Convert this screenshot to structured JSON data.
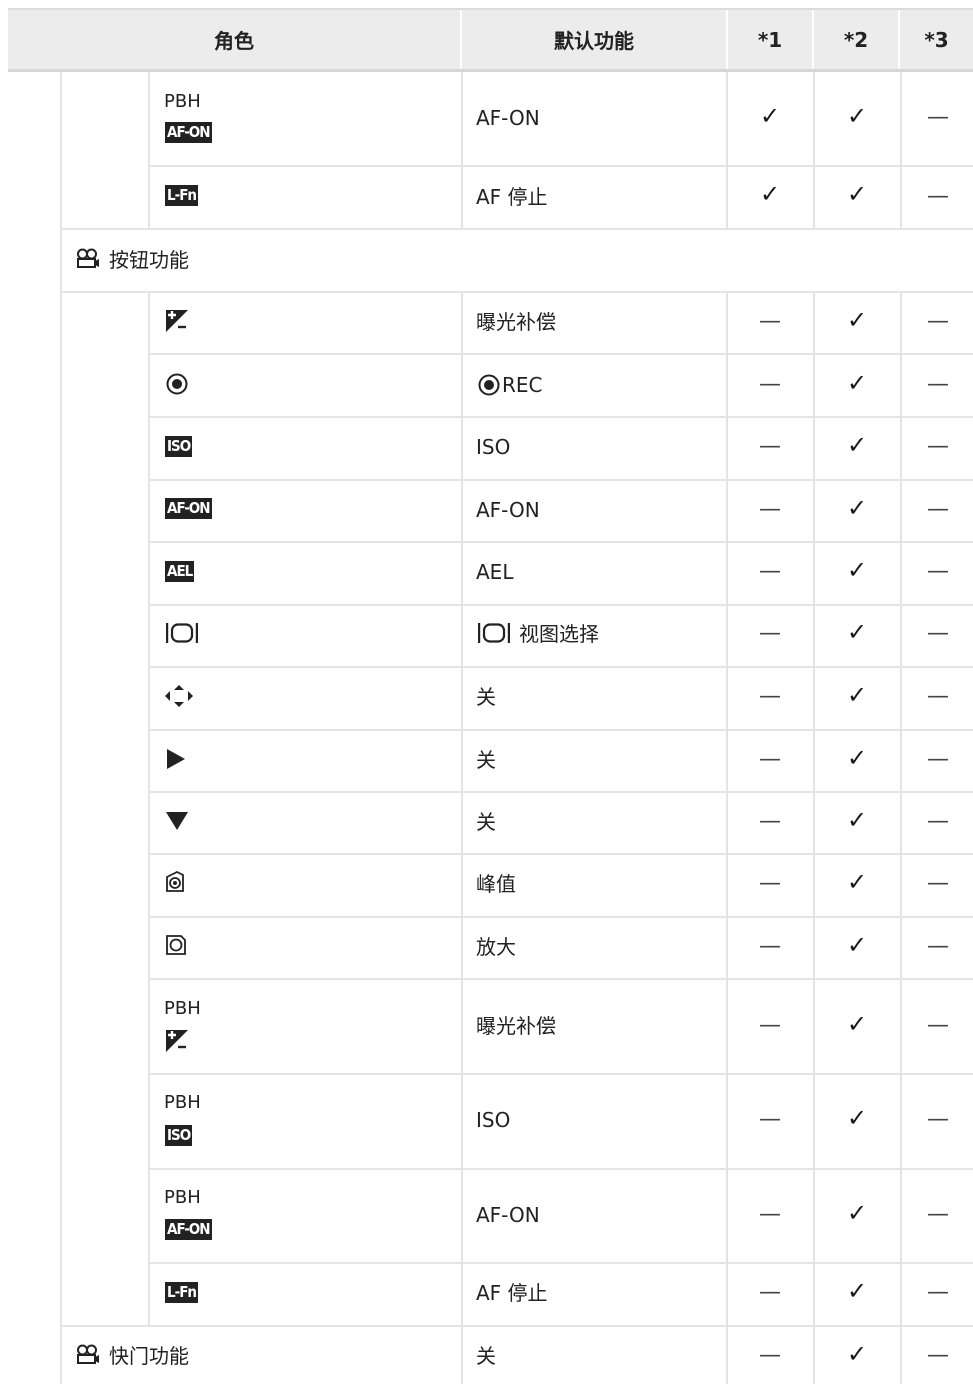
{
  "header": {
    "role": "角色",
    "default_function": "默认功能",
    "col1": "*1",
    "col2": "*2",
    "col3": "*3"
  },
  "marks": {
    "check": "✓",
    "dash": "—"
  },
  "rows": [
    {
      "label": "PBH",
      "icon": "AF-ON",
      "function": "AF-ON",
      "c1": "✓",
      "c2": "✓",
      "c3": "—"
    },
    {
      "label": "",
      "icon": "L-Fn",
      "function": "AF 停止",
      "c1": "✓",
      "c2": "✓",
      "c3": "—"
    },
    {
      "section": "按钮功能"
    },
    {
      "icon": "exposure-comp-icon",
      "function": "曝光补偿",
      "c1": "—",
      "c2": "✓",
      "c3": "—"
    },
    {
      "icon": "record-icon",
      "function": "REC",
      "c1": "—",
      "c2": "✓",
      "c3": "—"
    },
    {
      "icon": "ISO",
      "function": "ISO",
      "c1": "—",
      "c2": "✓",
      "c3": "—"
    },
    {
      "icon": "AF-ON",
      "function": "AF-ON",
      "c1": "—",
      "c2": "✓",
      "c3": "—"
    },
    {
      "icon": "AEL",
      "function": "AEL",
      "c1": "—",
      "c2": "✓",
      "c3": "—"
    },
    {
      "icon": "view-select-icon",
      "function": "视图选择",
      "c1": "—",
      "c2": "✓",
      "c3": "—"
    },
    {
      "icon": "arrow-pad-icon",
      "function": "关",
      "c1": "—",
      "c2": "✓",
      "c3": "—"
    },
    {
      "icon": "right-triangle-icon",
      "function": "关",
      "c1": "—",
      "c2": "✓",
      "c3": "—"
    },
    {
      "icon": "down-triangle-icon",
      "function": "关",
      "c1": "—",
      "c2": "✓",
      "c3": "—"
    },
    {
      "icon": "peaking-icon",
      "function": "峰值",
      "c1": "—",
      "c2": "✓",
      "c3": "—"
    },
    {
      "icon": "magnify-icon",
      "function": "放大",
      "c1": "—",
      "c2": "✓",
      "c3": "—"
    },
    {
      "label": "PBH",
      "icon": "exposure-comp-icon",
      "function": "曝光补偿",
      "c1": "—",
      "c2": "✓",
      "c3": "—"
    },
    {
      "label": "PBH",
      "icon": "ISO",
      "function": "ISO",
      "c1": "—",
      "c2": "✓",
      "c3": "—"
    },
    {
      "label": "PBH",
      "icon": "AF-ON",
      "function": "AF-ON",
      "c1": "—",
      "c2": "✓",
      "c3": "—"
    },
    {
      "label": "",
      "icon": "L-Fn",
      "function": "AF 停止",
      "c1": "—",
      "c2": "✓",
      "c3": "—"
    },
    {
      "section": "快门功能",
      "function": "关",
      "c1": "—",
      "c2": "✓",
      "c3": "—"
    }
  ],
  "texts": {
    "pbh": "PBH",
    "afon": "AF-ON",
    "lfn": "L-Fn",
    "iso": "ISO",
    "ael": "AEL",
    "af_stop": "AF 停止",
    "section_buttons": "按钮功能",
    "section_shutter": "快门功能",
    "exp_comp": "曝光补偿",
    "rec": "REC",
    "view_select": "视图选择",
    "off": "关",
    "peaking": "峰值",
    "magnify": "放大"
  }
}
